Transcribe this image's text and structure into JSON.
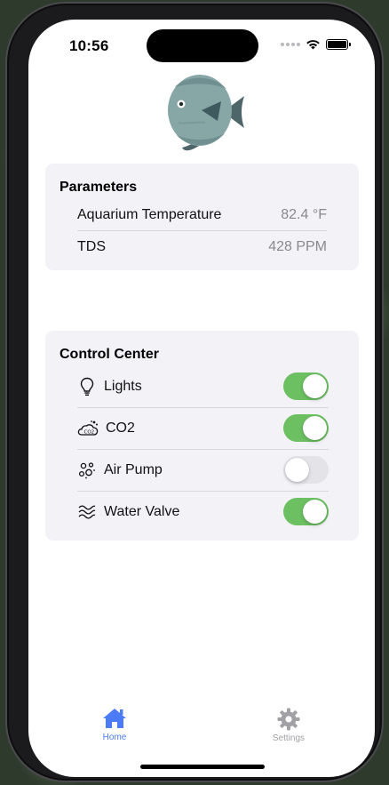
{
  "status_bar": {
    "time": "10:56"
  },
  "header": {
    "logo_icon": "discus-fish-icon"
  },
  "parameters": {
    "title": "Parameters",
    "rows": [
      {
        "label": "Aquarium Temperature",
        "value": "82.4 °F"
      },
      {
        "label": "TDS",
        "value": "428 PPM"
      }
    ]
  },
  "control_center": {
    "title": "Control Center",
    "items": [
      {
        "label": "Lights",
        "icon": "lightbulb-icon",
        "on": true
      },
      {
        "label": "CO2",
        "icon": "co2-cloud-icon",
        "on": true
      },
      {
        "label": "Air Pump",
        "icon": "bubbles-icon",
        "on": false
      },
      {
        "label": "Water Valve",
        "icon": "water-waves-icon",
        "on": true
      }
    ]
  },
  "tab_bar": {
    "items": [
      {
        "label": "Home",
        "icon": "house-icon",
        "active": true
      },
      {
        "label": "Settings",
        "icon": "gear-icon",
        "active": false
      }
    ]
  },
  "colors": {
    "accent": "#4b7cf5",
    "toggle_on": "#6cc062",
    "toggle_off": "#e3e3e8",
    "card_bg": "#f2f2f7",
    "tab_inactive": "#a0a0a5"
  }
}
